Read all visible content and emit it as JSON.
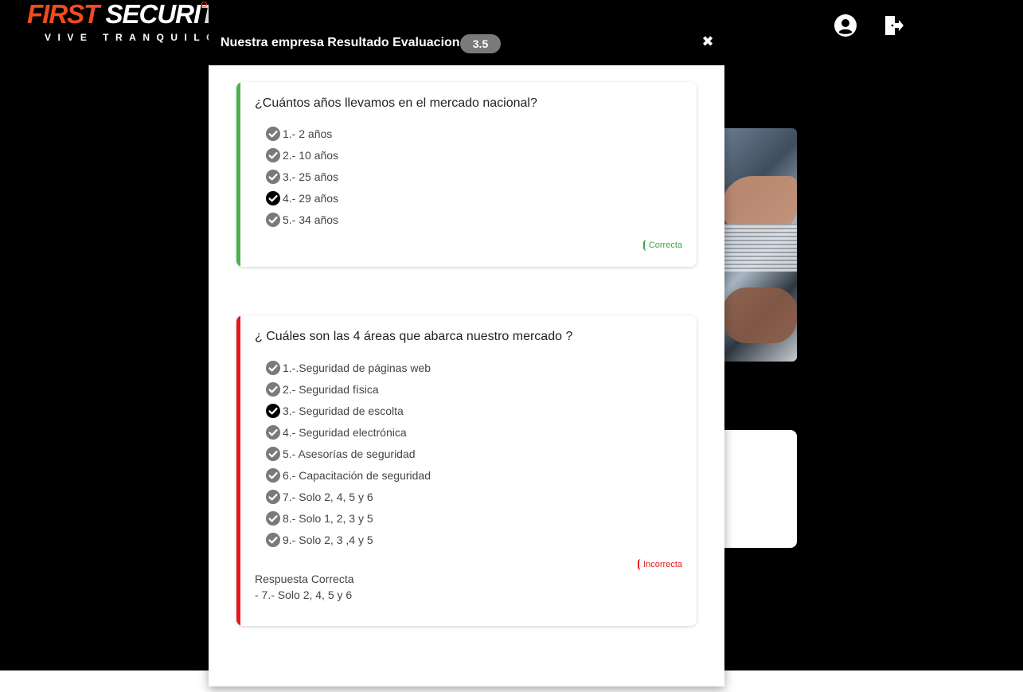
{
  "brand": {
    "first": "FIRST",
    "security": "SECURITY",
    "tagline": "VIVE TRANQUILO",
    "accent_color": "#f24b1c"
  },
  "header_icons": {
    "user": "user-circle-icon",
    "logout": "door-exit-icon"
  },
  "modal": {
    "title": "Nuestra empresa Resultado Evaluacion",
    "score": "3.5",
    "close_icon": "close-icon",
    "close_glyph": "✖"
  },
  "questions": [
    {
      "text": "¿Cuántos años llevamos en el mercado nacional?",
      "status": "correct",
      "result_label": "Correcta",
      "result_color": "#43a047",
      "options": [
        {
          "label": "1.- 2 años",
          "selected": false
        },
        {
          "label": "2.- 10 años",
          "selected": false
        },
        {
          "label": "3.- 25 años",
          "selected": false
        },
        {
          "label": "4.- 29 años",
          "selected": true
        },
        {
          "label": "5.- 34 años",
          "selected": false
        }
      ]
    },
    {
      "text": "¿ Cuáles son las 4 áreas que abarca nuestro mercado ?",
      "status": "incorrect",
      "result_label": "Incorrecta",
      "result_color": "#e8161c",
      "options": [
        {
          "label": "1.-.Seguridad de páginas web",
          "selected": false
        },
        {
          "label": "2.- Seguridad física",
          "selected": false
        },
        {
          "label": "3.- Seguridad de escolta",
          "selected": true
        },
        {
          "label": "4.- Seguridad electrónica",
          "selected": false
        },
        {
          "label": "5.- Asesorías de seguridad",
          "selected": false
        },
        {
          "label": "6.- Capacitación de seguridad",
          "selected": false
        },
        {
          "label": "7.- Solo 2, 4, 5 y 6",
          "selected": false
        },
        {
          "label": "8.- Solo 1, 2, 3 y 5",
          "selected": false
        },
        {
          "label": "9.- Solo 2, 3 ,4 y 5",
          "selected": false
        }
      ],
      "correct_answer_title": "Respuesta Correcta",
      "correct_answer_value": "- 7.- Solo 2, 4, 5 y 6"
    }
  ],
  "colors": {
    "check_default": "#7a7a7a",
    "check_selected": "#000000"
  }
}
